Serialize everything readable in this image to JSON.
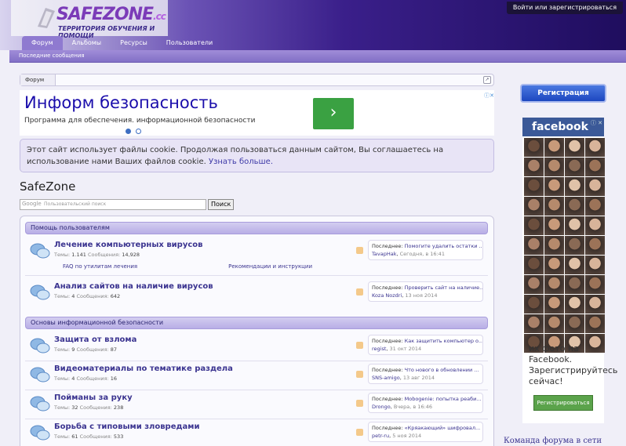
{
  "header": {
    "logo_main": "SAFEZONE",
    "logo_tld": ".cc",
    "logo_tagline": "ТЕРРИТОРИЯ ОБУЧЕНИЯ И ПОМОЩИ",
    "auth_link": "Войти или зарегистрироваться",
    "tabs": [
      "Форум",
      "Альбомы",
      "Ресурсы",
      "Пользователи"
    ],
    "subnav": "Последние сообщения"
  },
  "breadcrumb": {
    "item": "Форум"
  },
  "ad": {
    "title": "Информ безопасность",
    "desc": "Программа для обеспечения. информационной безопасности",
    "button": "›"
  },
  "cookie": {
    "text": "Этот сайт использует файлы cookie. Продолжая пользоваться данным сайтом, Вы соглашаетесь на использование нами Ваших файлов cookie.",
    "link": "Узнать больше."
  },
  "page_title": "SafeZone",
  "search": {
    "brand": "Google",
    "placeholder": "Пользовательский поиск",
    "button": "Поиск"
  },
  "categories": [
    {
      "title": "Помощь пользователям"
    },
    {
      "title": "Основы информационной безопасности"
    }
  ],
  "nodes": [
    {
      "title": "Лечение компьютерных вирусов",
      "threads_label": "Темы:",
      "threads": "1.141",
      "posts_label": "Сообщения:",
      "posts": "14,928",
      "last_label": "Последнее:",
      "last_title": "Помогите удалить остатки ...",
      "last_user": "TavapHak",
      "last_date": "Сегодня, в 16:41",
      "links": [
        "FAQ по утилитам лечения",
        "Рекомендации и инструкции"
      ]
    },
    {
      "title": "Анализ сайтов на наличие вирусов",
      "threads_label": "Темы:",
      "threads": "4",
      "posts_label": "Сообщения:",
      "posts": "642",
      "last_label": "Последнее:",
      "last_title": "Проверить сайт на наличие...",
      "last_user": "Koza Nozdri",
      "last_date": "13 ноя 2014"
    },
    {
      "title": "Защита от взлома",
      "threads_label": "Темы:",
      "threads": "9",
      "posts_label": "Сообщения:",
      "posts": "87",
      "last_label": "Последнее:",
      "last_title": "Как защитить компьютер о...",
      "last_user": "regist",
      "last_date": "31 окт 2014"
    },
    {
      "title": "Видеоматериалы по тематике раздела",
      "threads_label": "Темы:",
      "threads": "4",
      "posts_label": "Сообщения:",
      "posts": "16",
      "last_label": "Последнее:",
      "last_title": "Что нового в обновлении ...",
      "last_user": "SNS-amigo",
      "last_date": "13 авг 2014"
    },
    {
      "title": "Пойманы за руку",
      "threads_label": "Темы:",
      "threads": "32",
      "posts_label": "Сообщения:",
      "posts": "238",
      "last_label": "Последнее:",
      "last_title": "Mobogenie: попытка реаби...",
      "last_user": "Drongo",
      "last_date": "Вчера, в 16:46"
    },
    {
      "title": "Борьба с типовыми зловредами",
      "threads_label": "Темы:",
      "threads": "61",
      "posts_label": "Сообщения:",
      "posts": "533",
      "last_label": "Последнее:",
      "last_title": "«Кряакающий» шифровал...",
      "last_user": "petr-ru",
      "last_date": "5 ноя 2014"
    }
  ],
  "sidebar": {
    "register": "Регистрация",
    "fb_brand": "facebook",
    "fb_close": "ⓘ ✕",
    "fb_text": "их фото на Facebook. Зарегистрируйтесь сейчас!",
    "fb_button": "Регистрироваться",
    "team": "Команда форума в сети"
  },
  "colors": {
    "accent": "#3b3490",
    "header": "#3a1f8a",
    "facebook": "#3b5998"
  }
}
